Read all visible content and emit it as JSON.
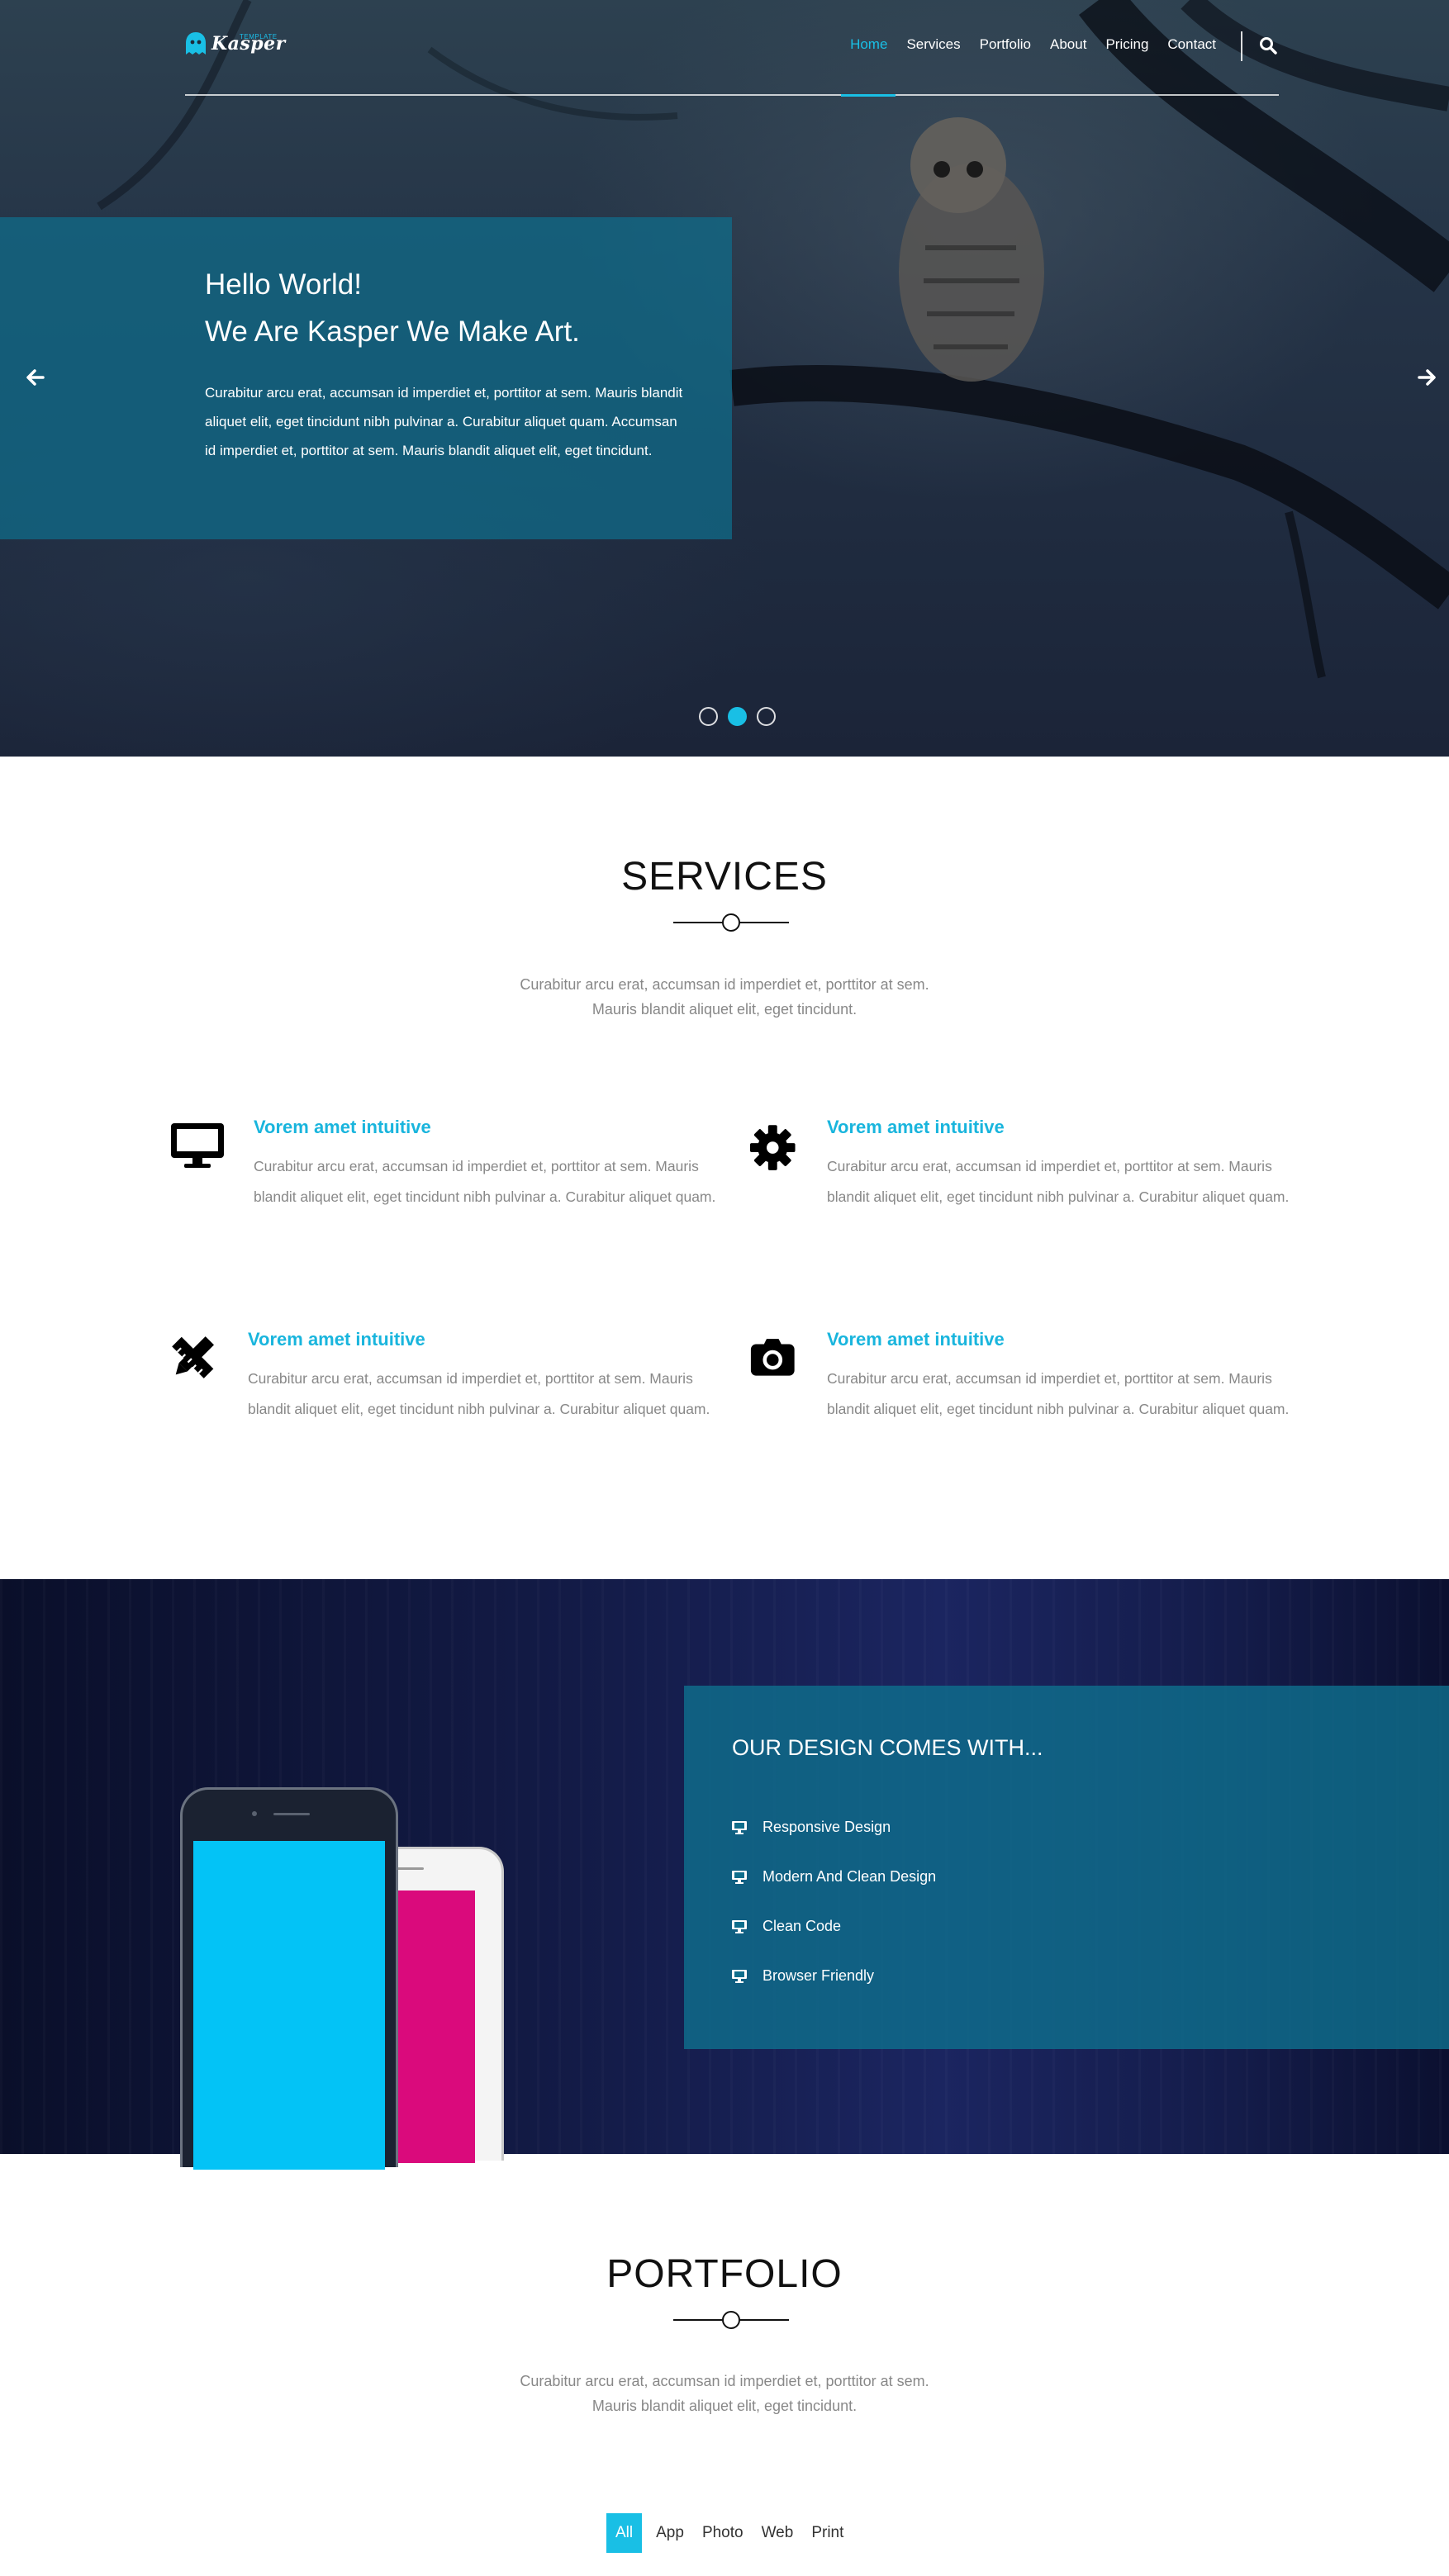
{
  "brand": {
    "name": "Kasper",
    "tagline": "TEMPLATE"
  },
  "nav": {
    "items": [
      {
        "label": "Home",
        "active": true
      },
      {
        "label": "Services",
        "active": false
      },
      {
        "label": "Portfolio",
        "active": false
      },
      {
        "label": "About",
        "active": false
      },
      {
        "label": "Pricing",
        "active": false
      },
      {
        "label": "Contact",
        "active": false
      }
    ],
    "search_icon": "search-icon"
  },
  "hero": {
    "title_line1": "Hello World!",
    "title_line2": "We Are Kasper We Make Art.",
    "text": "Curabitur arcu erat, accumsan id imperdiet et, porttitor at sem. Mauris blandit aliquet elit, eget tincidunt nibh pulvinar a. Curabitur aliquet quam. Accumsan id imperdiet et, porttitor at sem. Mauris blandit aliquet elit, eget tincidunt.",
    "prev_icon": "arrow-left-icon",
    "next_icon": "arrow-right-icon",
    "slides_total": 3,
    "slide_active": 2
  },
  "services": {
    "title": "SERVICES",
    "desc_line1": "Curabitur arcu erat, accumsan id imperdiet et, porttitor at sem.",
    "desc_line2": "Mauris blandit aliquet elit, eget tincidunt.",
    "items": [
      {
        "icon": "desktop-icon",
        "title": "Vorem amet intuitive",
        "text": "Curabitur arcu erat, accumsan id imperdiet et, porttitor at sem. Mauris blandit aliquet elit, eget tincidunt nibh pulvinar a. Curabitur aliquet quam."
      },
      {
        "icon": "gear-icon",
        "title": "Vorem amet intuitive",
        "text": "Curabitur arcu erat, accumsan id imperdiet et, porttitor at sem. Mauris blandit aliquet elit, eget tincidunt nibh pulvinar a. Curabitur aliquet quam."
      },
      {
        "icon": "pencil-ruler-icon",
        "title": "Vorem amet intuitive",
        "text": "Curabitur arcu erat, accumsan id imperdiet et, porttitor at sem. Mauris blandit aliquet elit, eget tincidunt nibh pulvinar a. Curabitur aliquet quam."
      },
      {
        "icon": "camera-icon",
        "title": "Vorem amet intuitive",
        "text": "Curabitur arcu erat, accumsan id imperdiet et, porttitor at sem. Mauris blandit aliquet elit, eget tincidunt nibh pulvinar a. Curabitur aliquet quam."
      }
    ]
  },
  "design": {
    "title": "OUR DESIGN COMES WITH...",
    "features": [
      {
        "icon": "desktop-icon",
        "label": "Responsive Design"
      },
      {
        "icon": "desktop-icon",
        "label": "Modern And Clean Design"
      },
      {
        "icon": "desktop-icon",
        "label": "Clean Code"
      },
      {
        "icon": "desktop-icon",
        "label": "Browser Friendly"
      }
    ]
  },
  "portfolio": {
    "title": "PORTFOLIO",
    "desc_line1": "Curabitur arcu erat, accumsan id imperdiet et, porttitor at sem.",
    "desc_line2": "Mauris blandit aliquet elit, eget tincidunt.",
    "filters": [
      {
        "label": "All",
        "active": true
      },
      {
        "label": "App",
        "active": false
      },
      {
        "label": "Photo",
        "active": false
      },
      {
        "label": "Web",
        "active": false
      },
      {
        "label": "Print",
        "active": false
      }
    ]
  },
  "colors": {
    "accent": "#19bfe5",
    "hero_box": "#0f6e8c",
    "design_bg": "#131b47",
    "phone_screen_blue": "#03c3f6",
    "phone_screen_pink": "#da0a7c"
  }
}
